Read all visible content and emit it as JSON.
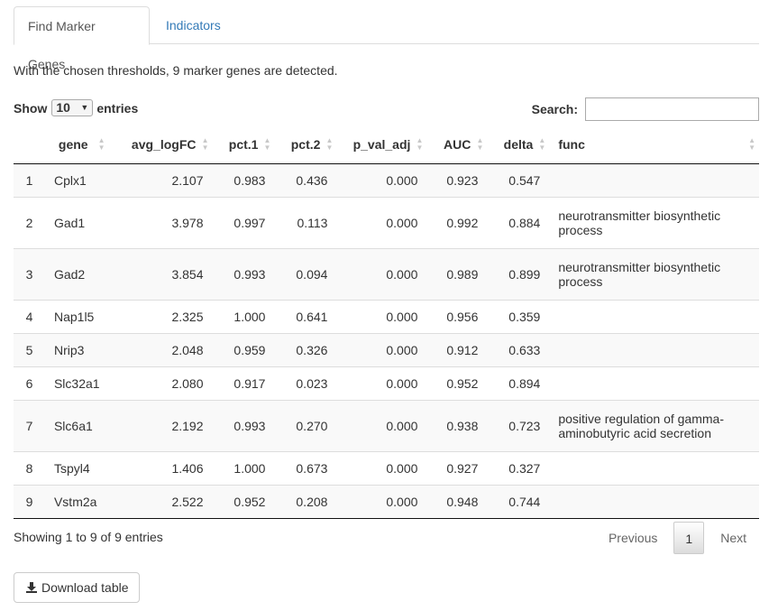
{
  "tabs": [
    {
      "label": "Find Marker Genes",
      "active": true
    },
    {
      "label": "Indicators",
      "active": false
    }
  ],
  "summary": "With the chosen thresholds, 9 marker genes are detected.",
  "length_control": {
    "show_label": "Show",
    "selected": "10",
    "entries_label": "entries"
  },
  "search": {
    "label": "Search:",
    "value": ""
  },
  "table": {
    "columns": [
      "",
      "gene",
      "avg_logFC",
      "pct.1",
      "pct.2",
      "p_val_adj",
      "AUC",
      "delta",
      "func"
    ],
    "rows": [
      [
        "1",
        "Cplx1",
        "2.107",
        "0.983",
        "0.436",
        "0.000",
        "0.923",
        "0.547",
        ""
      ],
      [
        "2",
        "Gad1",
        "3.978",
        "0.997",
        "0.113",
        "0.000",
        "0.992",
        "0.884",
        "neurotransmitter biosynthetic process"
      ],
      [
        "3",
        "Gad2",
        "3.854",
        "0.993",
        "0.094",
        "0.000",
        "0.989",
        "0.899",
        "neurotransmitter biosynthetic process"
      ],
      [
        "4",
        "Nap1l5",
        "2.325",
        "1.000",
        "0.641",
        "0.000",
        "0.956",
        "0.359",
        ""
      ],
      [
        "5",
        "Nrip3",
        "2.048",
        "0.959",
        "0.326",
        "0.000",
        "0.912",
        "0.633",
        ""
      ],
      [
        "6",
        "Slc32a1",
        "2.080",
        "0.917",
        "0.023",
        "0.000",
        "0.952",
        "0.894",
        ""
      ],
      [
        "7",
        "Slc6a1",
        "2.192",
        "0.993",
        "0.270",
        "0.000",
        "0.938",
        "0.723",
        "positive regulation of gamma-aminobutyric acid secretion"
      ],
      [
        "8",
        "Tspyl4",
        "1.406",
        "1.000",
        "0.673",
        "0.000",
        "0.927",
        "0.327",
        ""
      ],
      [
        "9",
        "Vstm2a",
        "2.522",
        "0.952",
        "0.208",
        "0.000",
        "0.948",
        "0.744",
        ""
      ]
    ]
  },
  "info": "Showing 1 to 9 of 9 entries",
  "pagination": {
    "previous": "Previous",
    "current": "1",
    "next": "Next"
  },
  "download_button": {
    "label": "Download table",
    "icon": "download-icon"
  }
}
